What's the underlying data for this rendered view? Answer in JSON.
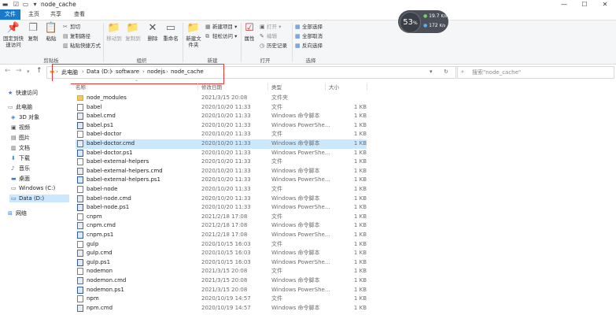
{
  "window": {
    "title": "node_cache"
  },
  "tabs": [
    {
      "label": "文件",
      "active": true
    },
    {
      "label": "主页",
      "active": false
    },
    {
      "label": "共享",
      "active": false
    },
    {
      "label": "查看",
      "active": false
    }
  ],
  "ribbon": {
    "clipboard": {
      "group_label": "剪贴板",
      "pin_label": "固定到快速访问",
      "copy_label": "复制",
      "paste_label": "粘贴",
      "cut_label": "剪切",
      "copy_path_label": "复制路径",
      "paste_shortcut_label": "粘贴快捷方式"
    },
    "organize": {
      "group_label": "组织",
      "move_to_label": "移动到",
      "copy_to_label": "复制到",
      "delete_label": "删除",
      "rename_label": "重命名"
    },
    "new": {
      "group_label": "新建",
      "new_folder_label": "新建文件夹",
      "new_item_label": "新建项目",
      "easy_access_label": "轻松访问"
    },
    "open": {
      "group_label": "打开",
      "properties_label": "属性",
      "open_label": "打开",
      "edit_label": "编辑",
      "history_label": "历史记录"
    },
    "select": {
      "group_label": "选择",
      "select_all_label": "全部选择",
      "select_none_label": "全部取消",
      "invert_label": "反向选择"
    }
  },
  "badge": {
    "percent": "53",
    "unit": "%",
    "up": "19.7",
    "down": "172",
    "up_unit": "K/s",
    "down_unit": "K/s"
  },
  "address": {
    "crumbs": [
      "此电脑",
      "Data (D:)",
      "software",
      "nodejs",
      "node_cache"
    ],
    "search_placeholder": "搜索\"node_cache\""
  },
  "navpane": [
    {
      "label": "快速访问",
      "icon": "star-icon",
      "indent": 0,
      "selected": false
    },
    {
      "label": "此电脑",
      "icon": "computer-icon",
      "indent": 0,
      "selected": false
    },
    {
      "label": "3D 对象",
      "icon": "cube-icon",
      "indent": 1,
      "selected": false
    },
    {
      "label": "视频",
      "icon": "video-icon",
      "indent": 1,
      "selected": false
    },
    {
      "label": "图片",
      "icon": "picture-icon",
      "indent": 1,
      "selected": false
    },
    {
      "label": "文档",
      "icon": "document-icon",
      "indent": 1,
      "selected": false
    },
    {
      "label": "下载",
      "icon": "download-icon",
      "indent": 1,
      "selected": false
    },
    {
      "label": "音乐",
      "icon": "music-icon",
      "indent": 1,
      "selected": false
    },
    {
      "label": "桌面",
      "icon": "desktop-icon",
      "indent": 1,
      "selected": false
    },
    {
      "label": "Windows (C:)",
      "icon": "drive-icon",
      "indent": 1,
      "selected": false
    },
    {
      "label": "Data (D:)",
      "icon": "drive-icon",
      "indent": 1,
      "selected": true
    },
    {
      "label": "网络",
      "icon": "network-icon",
      "indent": 0,
      "selected": false
    }
  ],
  "columns": {
    "name": "名称",
    "date": "修改日期",
    "type": "类型",
    "size": "大小"
  },
  "files": [
    {
      "name": "node_modules",
      "date": "2021/3/15 20:08",
      "type": "文件夹",
      "size": "",
      "kind": "folder"
    },
    {
      "name": "babel",
      "date": "2020/10/20 11:33",
      "type": "文件",
      "size": "1 KB",
      "kind": "file"
    },
    {
      "name": "babel.cmd",
      "date": "2020/10/20 11:33",
      "type": "Windows 命令脚本",
      "size": "1 KB",
      "kind": "cmd"
    },
    {
      "name": "babel.ps1",
      "date": "2020/10/20 11:33",
      "type": "Windows PowerShe...",
      "size": "1 KB",
      "kind": "ps1"
    },
    {
      "name": "babel-doctor",
      "date": "2020/10/20 11:33",
      "type": "文件",
      "size": "1 KB",
      "kind": "file"
    },
    {
      "name": "babel-doctor.cmd",
      "date": "2020/10/20 11:33",
      "type": "Windows 命令脚本",
      "size": "1 KB",
      "kind": "cmd",
      "selected": true
    },
    {
      "name": "babel-doctor.ps1",
      "date": "2020/10/20 11:33",
      "type": "Windows PowerShe...",
      "size": "1 KB",
      "kind": "ps1"
    },
    {
      "name": "babel-external-helpers",
      "date": "2020/10/20 11:33",
      "type": "文件",
      "size": "1 KB",
      "kind": "file"
    },
    {
      "name": "babel-external-helpers.cmd",
      "date": "2020/10/20 11:33",
      "type": "Windows 命令脚本",
      "size": "1 KB",
      "kind": "cmd"
    },
    {
      "name": "babel-external-helpers.ps1",
      "date": "2020/10/20 11:33",
      "type": "Windows PowerShe...",
      "size": "1 KB",
      "kind": "ps1"
    },
    {
      "name": "babel-node",
      "date": "2020/10/20 11:33",
      "type": "文件",
      "size": "1 KB",
      "kind": "file"
    },
    {
      "name": "babel-node.cmd",
      "date": "2020/10/20 11:33",
      "type": "Windows 命令脚本",
      "size": "1 KB",
      "kind": "cmd"
    },
    {
      "name": "babel-node.ps1",
      "date": "2020/10/20 11:33",
      "type": "Windows PowerShe...",
      "size": "1 KB",
      "kind": "ps1"
    },
    {
      "name": "cnpm",
      "date": "2021/2/18 17:08",
      "type": "文件",
      "size": "1 KB",
      "kind": "file"
    },
    {
      "name": "cnpm.cmd",
      "date": "2021/2/18 17:08",
      "type": "Windows 命令脚本",
      "size": "1 KB",
      "kind": "cmd"
    },
    {
      "name": "cnpm.ps1",
      "date": "2021/2/18 17:08",
      "type": "Windows PowerShe...",
      "size": "1 KB",
      "kind": "ps1"
    },
    {
      "name": "gulp",
      "date": "2020/10/15 16:03",
      "type": "文件",
      "size": "1 KB",
      "kind": "file"
    },
    {
      "name": "gulp.cmd",
      "date": "2020/10/15 16:03",
      "type": "Windows 命令脚本",
      "size": "1 KB",
      "kind": "cmd"
    },
    {
      "name": "gulp.ps1",
      "date": "2020/10/15 16:03",
      "type": "Windows PowerShe...",
      "size": "1 KB",
      "kind": "ps1"
    },
    {
      "name": "nodemon",
      "date": "2021/3/15 20:08",
      "type": "文件",
      "size": "1 KB",
      "kind": "file"
    },
    {
      "name": "nodemon.cmd",
      "date": "2021/3/15 20:08",
      "type": "Windows 命令脚本",
      "size": "1 KB",
      "kind": "cmd"
    },
    {
      "name": "nodemon.ps1",
      "date": "2021/3/15 20:08",
      "type": "Windows PowerShe...",
      "size": "1 KB",
      "kind": "ps1"
    },
    {
      "name": "npm",
      "date": "2020/10/19 14:57",
      "type": "文件",
      "size": "1 KB",
      "kind": "file"
    },
    {
      "name": "npm.cmd",
      "date": "2020/10/19 14:57",
      "type": "Windows 命令脚本",
      "size": "1 KB",
      "kind": "cmd"
    }
  ],
  "colors": {
    "accent": "#1979ca",
    "selection": "#cce8ff",
    "highlight_box": "#e83535"
  }
}
